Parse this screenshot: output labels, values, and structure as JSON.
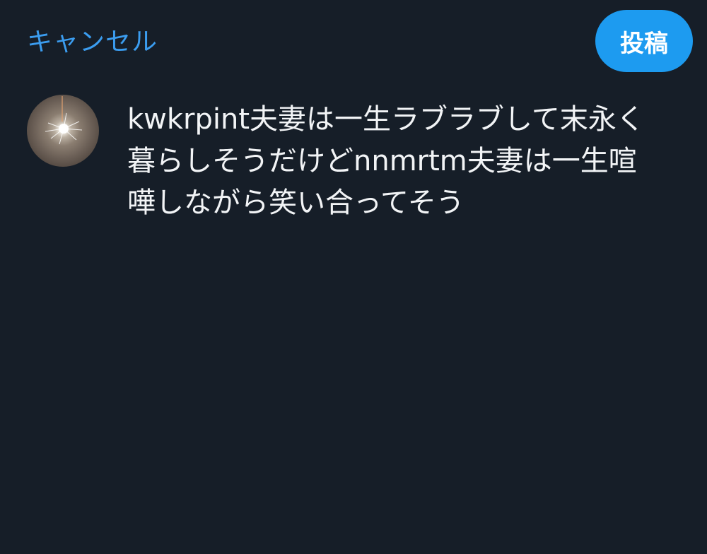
{
  "header": {
    "cancel_label": "キャンセル",
    "post_label": "投稿"
  },
  "composer": {
    "text": "kwkrpint夫妻は一生ラブラブして末永く\n暮らしそうだけどnnmrtm夫妻は一生喧\n嘩しながら笑い合ってそう"
  },
  "colors": {
    "background": "#161e28",
    "accent": "#1d9bf0",
    "cancel_text": "#3b9df0",
    "body_text": "#f2f4f6"
  }
}
